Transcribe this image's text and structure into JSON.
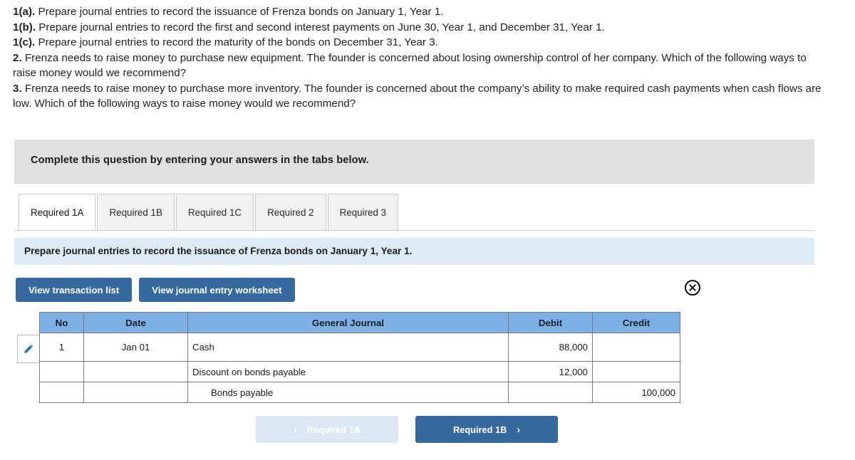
{
  "prompt": {
    "lines": [
      {
        "lead": "1(a).",
        "text": " Prepare journal entries to record the issuance of Frenza bonds on January 1, Year 1."
      },
      {
        "lead": "1(b).",
        "text": " Prepare journal entries to record the first and second interest payments on June 30, Year 1, and December 31, Year 1."
      },
      {
        "lead": "1(c).",
        "text": " Prepare journal entries to record the maturity of the bonds on December 31, Year 3."
      },
      {
        "lead": "2.",
        "text": " Frenza needs to raise money to purchase new equipment. The founder is concerned about losing ownership control of her company. Which of the following ways to raise money would we recommend?"
      },
      {
        "lead": "3.",
        "text": " Frenza needs to raise money to purchase more inventory. The founder is concerned about the company’s ability to make required cash payments when cash flows are low. Which of the following ways to raise money would we recommend?"
      }
    ]
  },
  "banner": {
    "text": "Complete this question by entering your answers in the tabs below."
  },
  "tabs": [
    {
      "label": "Required 1A",
      "active": true
    },
    {
      "label": "Required 1B",
      "active": false
    },
    {
      "label": "Required 1C",
      "active": false
    },
    {
      "label": "Required 2",
      "active": false
    },
    {
      "label": "Required 3",
      "active": false
    }
  ],
  "requirement_strip": {
    "text": "Prepare journal entries to record the issuance of Frenza bonds on January 1, Year 1."
  },
  "toolbar": {
    "view_transaction_list": "View transaction list",
    "view_journal_entry_worksheet": "View journal entry worksheet",
    "close_icon": "close-circle-icon",
    "edit_icon": "pencil-icon"
  },
  "journal_table": {
    "columns": [
      "No",
      "Date",
      "General Journal",
      "Debit",
      "Credit"
    ],
    "rows": [
      {
        "no": "1",
        "date": "Jan 01",
        "account": "Cash",
        "indent": false,
        "debit": "88,000",
        "credit": ""
      },
      {
        "no": "",
        "date": "",
        "account": "Discount on bonds payable",
        "indent": false,
        "debit": "12,000",
        "credit": ""
      },
      {
        "no": "",
        "date": "",
        "account": "Bonds payable",
        "indent": true,
        "debit": "",
        "credit": "100,000"
      }
    ]
  },
  "nav": {
    "prev_label": "Required 1A",
    "next_label": "Required 1B",
    "prev_chevron": "‹",
    "next_chevron": "›",
    "prev_disabled": true
  },
  "colors": {
    "accent_blue": "#36699e",
    "table_header_blue": "#7fb0e3",
    "strip_blue": "#ddebf7",
    "banner_gray": "#e0e0e0",
    "disabled_blue": "#dbe7f3"
  }
}
